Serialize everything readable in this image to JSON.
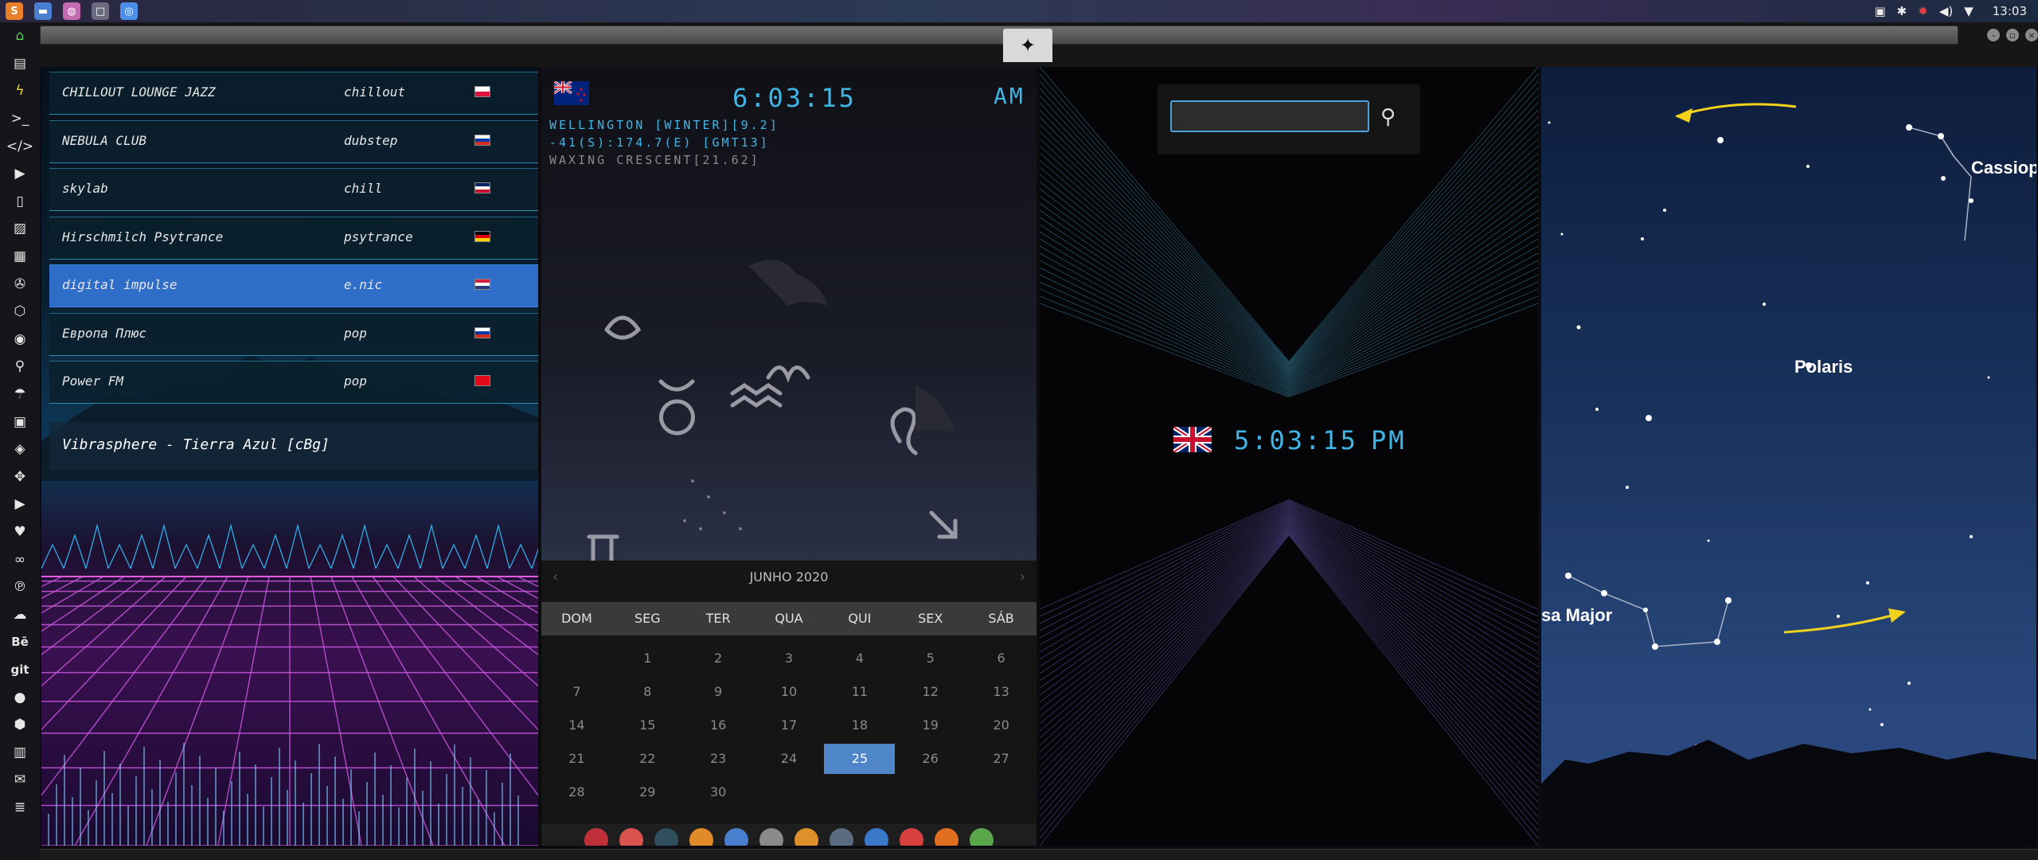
{
  "taskbar": {
    "apps": [
      {
        "name": "sublime-text-icon",
        "color": "#e8802a",
        "glyph": "S"
      },
      {
        "name": "folder-icon",
        "color": "#4a7fd0",
        "glyph": "▬"
      },
      {
        "name": "cerebro-icon",
        "color": "#c46ab0",
        "glyph": "◍"
      },
      {
        "name": "window-icon",
        "color": "#6b6b80",
        "glyph": "□"
      },
      {
        "name": "chromium-icon",
        "color": "#4d8ee8",
        "glyph": "◎"
      }
    ],
    "clock": "13:03"
  },
  "radio": {
    "stations": [
      {
        "name": "CHILLOUT LOUNGE JAZZ",
        "genre": "chillout",
        "flag_colors": [
          "#ffffff",
          "#dc143c"
        ],
        "selected": false
      },
      {
        "name": "NEBULA CLUB",
        "genre": "dubstep",
        "flag_colors": [
          "#ffffff",
          "#0039a6",
          "#d52b1e"
        ],
        "selected": false
      },
      {
        "name": "skylab",
        "genre": "chill",
        "flag_colors": [
          "#012169",
          "#ffffff",
          "#c8102e"
        ],
        "selected": false
      },
      {
        "name": "Hirschmilch Psytrance",
        "genre": "psytrance",
        "flag_colors": [
          "#000000",
          "#dd0000",
          "#ffce00"
        ],
        "selected": false
      },
      {
        "name": "digital impulse",
        "genre": "e.nic",
        "flag_colors": [
          "#d4213d",
          "#ffffff",
          "#253b80"
        ],
        "selected": true
      },
      {
        "name": "Европа Плюс",
        "genre": "pop",
        "flag_colors": [
          "#ffffff",
          "#0039a6",
          "#d52b1e"
        ],
        "selected": false
      },
      {
        "name": "Power FM",
        "genre": "pop",
        "flag_colors": [
          "#e30a17",
          "#e30a17"
        ],
        "selected": false
      }
    ],
    "now_playing": "Vibrasphere - Tierra Azul [cBg]"
  },
  "world_clock": {
    "time": "6:03:15",
    "ampm": "AM",
    "line1": "WELLINGTON [WINTER][9.2]",
    "line2": "-41(S):174.7(E) [GMT13]",
    "line3": "WAXING CRESCENT[21.62]"
  },
  "calendar": {
    "month": "JUNHO 2020",
    "days": [
      "DOM",
      "SEG",
      "TER",
      "QUA",
      "QUI",
      "SEX",
      "SÁB"
    ],
    "weeks": [
      [
        "",
        "1",
        "2",
        "3",
        "4",
        "5",
        "6"
      ],
      [
        "7",
        "8",
        "9",
        "10",
        "11",
        "12",
        "13"
      ],
      [
        "14",
        "15",
        "16",
        "17",
        "18",
        "19",
        "20"
      ],
      [
        "21",
        "22",
        "23",
        "24",
        "25",
        "26",
        "27"
      ],
      [
        "28",
        "29",
        "30",
        "",
        "",
        "",
        ""
      ]
    ],
    "today": "25"
  },
  "dock": {
    "items": [
      {
        "name": "arch-icon",
        "color": "#c0303a"
      },
      {
        "name": "hourglass-icon",
        "color": "#d9534f"
      },
      {
        "name": "globe-dark-icon",
        "color": "#2f4f5f"
      },
      {
        "name": "photo-viewer-icon",
        "color": "#e08a2a"
      },
      {
        "name": "translate-icon",
        "color": "#4a7fd0"
      },
      {
        "name": "news-icon",
        "color": "#8a8a8a"
      },
      {
        "name": "search-app-icon",
        "color": "#e0902a"
      },
      {
        "name": "clock-icon",
        "color": "#5a6a80"
      },
      {
        "name": "browser-globe-icon",
        "color": "#3a78c9"
      },
      {
        "name": "calendar-app-icon",
        "color": "#d84040"
      },
      {
        "name": "terminal-arrow-icon",
        "color": "#e07020"
      },
      {
        "name": "yandex-icon",
        "color": "#5aa64a"
      }
    ]
  },
  "search": {
    "value": "",
    "placeholder": ""
  },
  "uk_clock": {
    "time": "5:03:15",
    "ampm": "PM"
  },
  "sky": {
    "labels": [
      "Cassiop",
      "Polaris",
      "sa Major"
    ]
  }
}
